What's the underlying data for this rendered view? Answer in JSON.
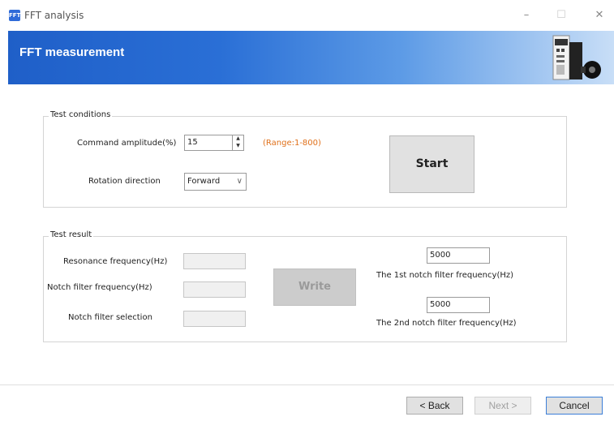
{
  "window": {
    "app_icon": "FFT",
    "title": "FFT analysis",
    "controls": {
      "minimize": "–",
      "maximize": "☐",
      "close": "✕"
    }
  },
  "banner": {
    "title": "FFT measurement",
    "image_icon": "servo-drive-image"
  },
  "test_conditions": {
    "caption": "Test conditions",
    "command_amplitude_label": "Command amplitude(%)",
    "command_amplitude_value": "15",
    "range_hint": "(Range:1-800)",
    "rotation_direction_label": "Rotation direction",
    "rotation_direction_value": "Forward",
    "start_label": "Start"
  },
  "test_result": {
    "caption": "Test result",
    "resonance_label": "Resonance frequency(Hz)",
    "resonance_value": "",
    "notch_freq_label": "Notch filter frequency(Hz)",
    "notch_freq_value": "",
    "notch_selection_label": "Notch filter selection",
    "notch_selection_value": "",
    "write_label": "Write",
    "notch1_value": "5000",
    "notch1_caption": "The 1st notch filter frequency(Hz)",
    "notch2_value": "5000",
    "notch2_caption": "The 2nd notch filter frequency(Hz)"
  },
  "footer": {
    "back_label": "< Back",
    "next_label": "Next >",
    "cancel_label": "Cancel"
  },
  "colors": {
    "banner_start": "#1f5fc8",
    "range_hint": "#e0701a"
  }
}
